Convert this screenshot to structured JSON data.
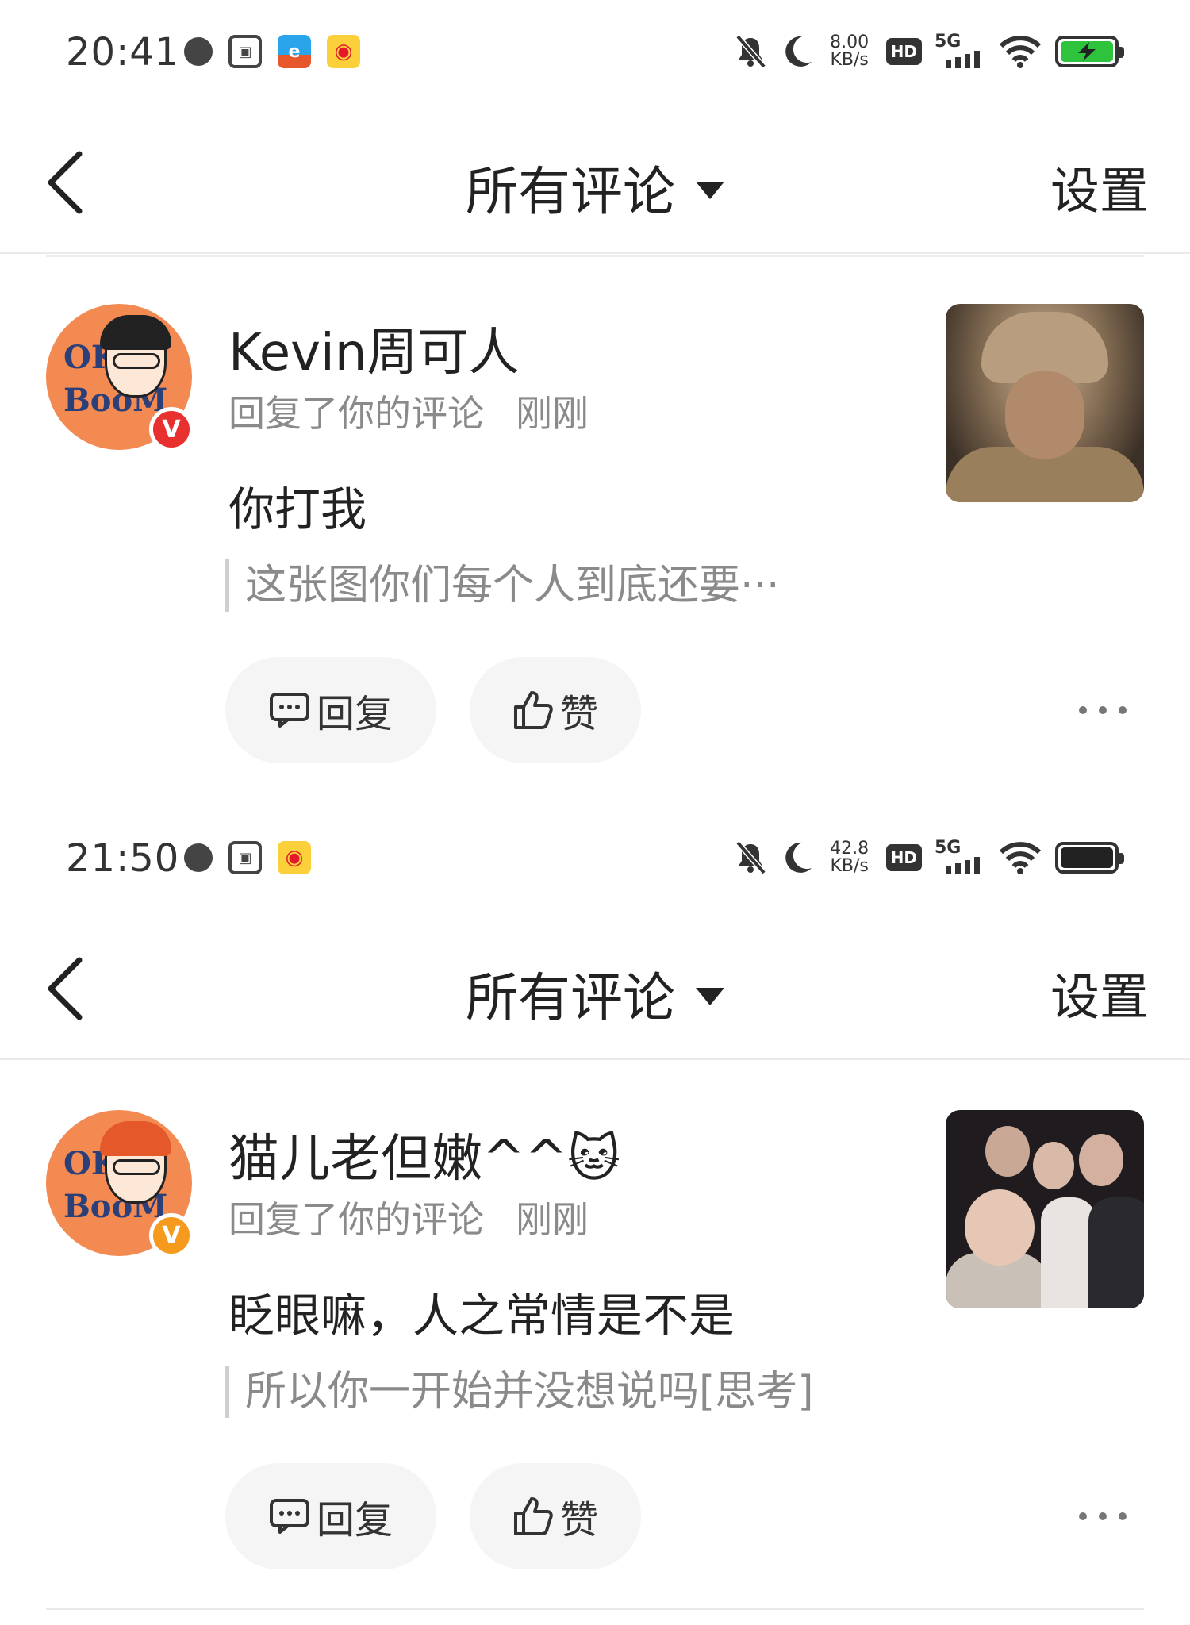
{
  "screens": [
    {
      "status": {
        "time": "20:41",
        "speed_value": "8.00",
        "speed_unit": "KB/s",
        "hd": "HD",
        "network": "5G",
        "battery_state": "charging",
        "left_icons": [
          "globe-icon",
          "scan-box-icon",
          "app-icon",
          "weibo-icon"
        ]
      },
      "nav": {
        "title": "所有评论",
        "settings": "设置"
      },
      "comment": {
        "name": "Kevin周可人",
        "action": "回复了你的评论",
        "time": "刚刚",
        "text": "你打我",
        "quote": "这张图你们每个人到底还要···",
        "reply_label": "回复",
        "like_label": "赞",
        "badge_color": "#e8312f"
      }
    },
    {
      "status": {
        "time": "21:50",
        "speed_value": "42.8",
        "speed_unit": "KB/s",
        "hd": "HD",
        "network": "5G",
        "battery_state": "full",
        "left_icons": [
          "globe-icon",
          "scan-box-icon",
          "weibo-icon"
        ]
      },
      "nav": {
        "title": "所有评论",
        "settings": "设置"
      },
      "comment": {
        "name": "猫儿老但嫩^^🐱",
        "action": "回复了你的评论",
        "time": "刚刚",
        "text": "眨眼嘛，人之常情是不是",
        "quote": "所以你一开始并没想说吗[思考]",
        "reply_label": "回复",
        "like_label": "赞",
        "badge_color": "#f59a1c"
      }
    }
  ],
  "avatar_text": {
    "ok": "OK",
    "boom": "BooM"
  },
  "colors": {
    "avatar_bg": "#f38a52",
    "battery_green": "#2ec33c",
    "accent_text": "#222222",
    "meta_text": "#8a8a8a"
  }
}
